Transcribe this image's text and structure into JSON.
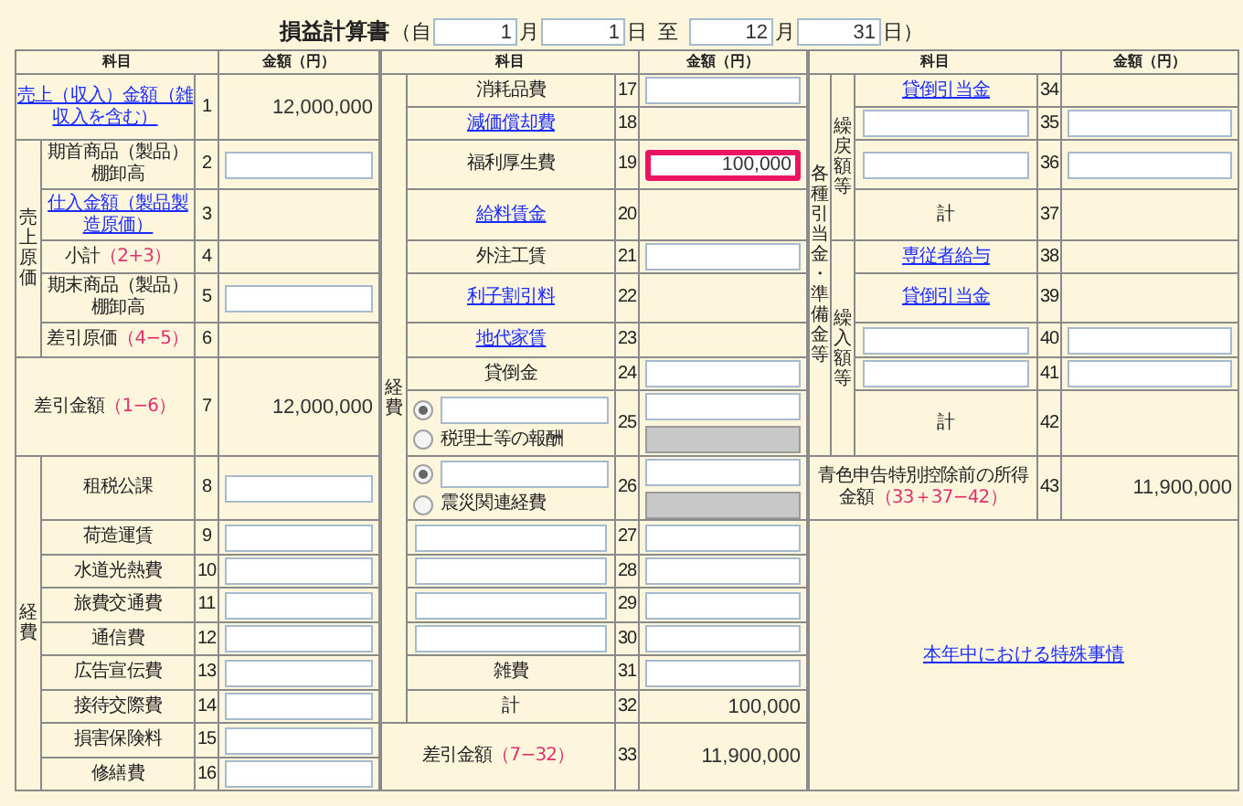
{
  "title": "損益計算書",
  "period": {
    "open": "（自",
    "from_month": "1",
    "month_unit": "月",
    "from_day": "1",
    "day_unit": "日",
    "to": "至",
    "to_month": "12",
    "to_month_unit": "月",
    "to_day": "31",
    "close": "日）"
  },
  "sections": [
    {
      "columns": [
        "科目",
        "金額（円）"
      ],
      "rows": [
        {
          "kind": "row",
          "no": "1",
          "label": {
            "kind": "link",
            "text": "売上（収入）金額（雑収入を含む）"
          },
          "amount": {
            "kind": "text",
            "text": "12,000,000"
          }
        },
        {
          "kind": "group",
          "label": "売上原価",
          "rows": [
            {
              "kind": "row",
              "no": "2",
              "label": {
                "kind": "text",
                "text": "期首商品（製品）棚卸高"
              },
              "amount": {
                "kind": "input",
                "focused": false
              }
            },
            {
              "kind": "row",
              "no": "3",
              "label": {
                "kind": "link",
                "text": "仕入金額（製品製造原価）"
              }
            },
            {
              "kind": "row",
              "no": "4",
              "label": {
                "kind": "text",
                "text": "小計",
                "formula": "（2+3）"
              }
            },
            {
              "kind": "row",
              "no": "5",
              "label": {
                "kind": "text",
                "text": "期末商品（製品）棚卸高"
              },
              "amount": {
                "kind": "input",
                "focused": false
              }
            },
            {
              "kind": "row",
              "no": "6",
              "label": {
                "kind": "text",
                "text": "差引原価",
                "formula": "（4−5）"
              }
            }
          ]
        },
        {
          "kind": "row",
          "no": "7",
          "label": {
            "kind": "text",
            "text": "差引金額",
            "formula": "（1−6）"
          },
          "amount": {
            "kind": "text",
            "text": "12,000,000"
          }
        },
        {
          "kind": "group",
          "label": "経費",
          "rows": [
            {
              "kind": "row",
              "no": "8",
              "label": {
                "kind": "text",
                "text": "租税公課"
              },
              "amount": {
                "kind": "input",
                "focused": false
              }
            },
            {
              "kind": "row",
              "no": "9",
              "label": {
                "kind": "text",
                "text": "荷造運賃"
              },
              "amount": {
                "kind": "input",
                "focused": false
              }
            },
            {
              "kind": "row",
              "no": "10",
              "label": {
                "kind": "text",
                "text": "水道光熱費"
              },
              "amount": {
                "kind": "input",
                "focused": false
              }
            },
            {
              "kind": "row",
              "no": "11",
              "label": {
                "kind": "text",
                "text": "旅費交通費"
              },
              "amount": {
                "kind": "input",
                "focused": false
              }
            },
            {
              "kind": "row",
              "no": "12",
              "label": {
                "kind": "text",
                "text": "通信費"
              },
              "amount": {
                "kind": "input",
                "focused": false
              }
            },
            {
              "kind": "row",
              "no": "13",
              "label": {
                "kind": "text",
                "text": "広告宣伝費"
              },
              "amount": {
                "kind": "input",
                "focused": false
              }
            },
            {
              "kind": "row",
              "no": "14",
              "label": {
                "kind": "text",
                "text": "接待交際費"
              },
              "amount": {
                "kind": "input",
                "focused": false
              }
            },
            {
              "kind": "row",
              "no": "15",
              "label": {
                "kind": "text",
                "text": "損害保険料"
              },
              "amount": {
                "kind": "input",
                "focused": false
              }
            },
            {
              "kind": "row",
              "no": "16",
              "label": {
                "kind": "text",
                "text": "修繕費"
              },
              "amount": {
                "kind": "input",
                "focused": false
              }
            }
          ]
        }
      ]
    },
    {
      "columns": [
        "科目",
        "金額（円）"
      ],
      "rows": [
        {
          "kind": "group",
          "label": "経費",
          "rows": [
            {
              "kind": "row",
              "no": "17",
              "label": {
                "kind": "text",
                "text": "消耗品費"
              },
              "amount": {
                "kind": "input",
                "focused": false
              }
            },
            {
              "kind": "row",
              "no": "18",
              "label": {
                "kind": "link",
                "text": "減価償却費"
              }
            },
            {
              "kind": "row",
              "no": "19",
              "label": {
                "kind": "text",
                "text": "福利厚生費"
              },
              "amount": {
                "kind": "input",
                "value": "100,000",
                "focused": true
              }
            },
            {
              "kind": "row",
              "no": "20",
              "label": {
                "kind": "link",
                "text": "給料賃金"
              }
            },
            {
              "kind": "row",
              "no": "21",
              "label": {
                "kind": "text",
                "text": "外注工賃"
              },
              "amount": {
                "kind": "input",
                "focused": false
              }
            },
            {
              "kind": "row",
              "no": "22",
              "label": {
                "kind": "link",
                "text": "利子割引料"
              }
            },
            {
              "kind": "row",
              "no": "23",
              "label": {
                "kind": "link",
                "text": "地代家賃"
              }
            },
            {
              "kind": "row",
              "no": "24",
              "label": {
                "kind": "text",
                "text": "貸倒金"
              },
              "amount": {
                "kind": "input",
                "focused": false
              }
            },
            {
              "kind": "row",
              "no": "25",
              "label": {
                "kind": "radio",
                "options": [
                  {
                    "kind": "input",
                    "selected": true
                  },
                  {
                    "kind": "text",
                    "text": "税理士等の報酬",
                    "selected": false
                  }
                ]
              },
              "amount": {
                "kind": "inputs",
                "inputs": [
                  {
                    "disabled": false
                  },
                  {
                    "disabled": true
                  }
                ]
              }
            },
            {
              "kind": "row",
              "no": "26",
              "label": {
                "kind": "radio",
                "options": [
                  {
                    "kind": "input",
                    "selected": true
                  },
                  {
                    "kind": "text",
                    "text": "震災関連経費",
                    "selected": false
                  }
                ]
              },
              "amount": {
                "kind": "inputs",
                "inputs": [
                  {
                    "disabled": false
                  },
                  {
                    "disabled": true
                  }
                ]
              }
            },
            {
              "kind": "row",
              "no": "27",
              "label": {
                "kind": "input"
              },
              "amount": {
                "kind": "input",
                "focused": false
              }
            },
            {
              "kind": "row",
              "no": "28",
              "label": {
                "kind": "input"
              },
              "amount": {
                "kind": "input",
                "focused": false
              }
            },
            {
              "kind": "row",
              "no": "29",
              "label": {
                "kind": "input"
              },
              "amount": {
                "kind": "input",
                "focused": false
              }
            },
            {
              "kind": "row",
              "no": "30",
              "label": {
                "kind": "input"
              },
              "amount": {
                "kind": "input",
                "focused": false
              }
            },
            {
              "kind": "row",
              "no": "31",
              "label": {
                "kind": "text",
                "text": "雑費"
              },
              "amount": {
                "kind": "input",
                "focused": false
              }
            },
            {
              "kind": "row",
              "no": "32",
              "label": {
                "kind": "text",
                "text": "計"
              },
              "amount": {
                "kind": "text",
                "text": "100,000"
              }
            }
          ]
        },
        {
          "kind": "row",
          "no": "33",
          "label": {
            "kind": "text",
            "text": "差引金額",
            "formula": "（7−32）"
          },
          "amount": {
            "kind": "text",
            "text": "11,900,000"
          }
        }
      ]
    },
    {
      "columns": [
        "科目",
        "金額（円）"
      ],
      "rows": [
        {
          "kind": "group",
          "label": "各種引当金・準備金等",
          "rows": [
            {
              "kind": "group",
              "label": "繰戻額等",
              "rows": [
                {
                  "kind": "row",
                  "no": "34",
                  "label": {
                    "kind": "link",
                    "text": "貸倒引当金"
                  }
                },
                {
                  "kind": "row",
                  "no": "35",
                  "label": {
                    "kind": "input"
                  },
                  "amount": {
                    "kind": "input",
                    "focused": false
                  }
                },
                {
                  "kind": "row",
                  "no": "36",
                  "label": {
                    "kind": "input"
                  },
                  "amount": {
                    "kind": "input",
                    "focused": false
                  }
                },
                {
                  "kind": "row",
                  "no": "37",
                  "label": {
                    "kind": "text",
                    "text": "計"
                  }
                }
              ]
            },
            {
              "kind": "group",
              "label": "繰入額等",
              "rows": [
                {
                  "kind": "row",
                  "no": "38",
                  "label": {
                    "kind": "link",
                    "text": "専従者給与"
                  }
                },
                {
                  "kind": "row",
                  "no": "39",
                  "label": {
                    "kind": "link",
                    "text": "貸倒引当金"
                  }
                },
                {
                  "kind": "row",
                  "no": "40",
                  "label": {
                    "kind": "input"
                  },
                  "amount": {
                    "kind": "input",
                    "focused": false
                  }
                },
                {
                  "kind": "row",
                  "no": "41",
                  "label": {
                    "kind": "input"
                  },
                  "amount": {
                    "kind": "input",
                    "focused": false
                  }
                },
                {
                  "kind": "row",
                  "no": "42",
                  "label": {
                    "kind": "text",
                    "text": "計"
                  }
                }
              ]
            }
          ]
        },
        {
          "kind": "row",
          "no": "43",
          "label": {
            "kind": "text",
            "text": "青色申告特別控除前の所得金額",
            "formula": "（33＋37−42）"
          },
          "amount": {
            "kind": "text",
            "text": "11,900,000"
          }
        },
        {
          "kind": "note",
          "label": "本年中における特殊事情"
        }
      ]
    }
  ]
}
